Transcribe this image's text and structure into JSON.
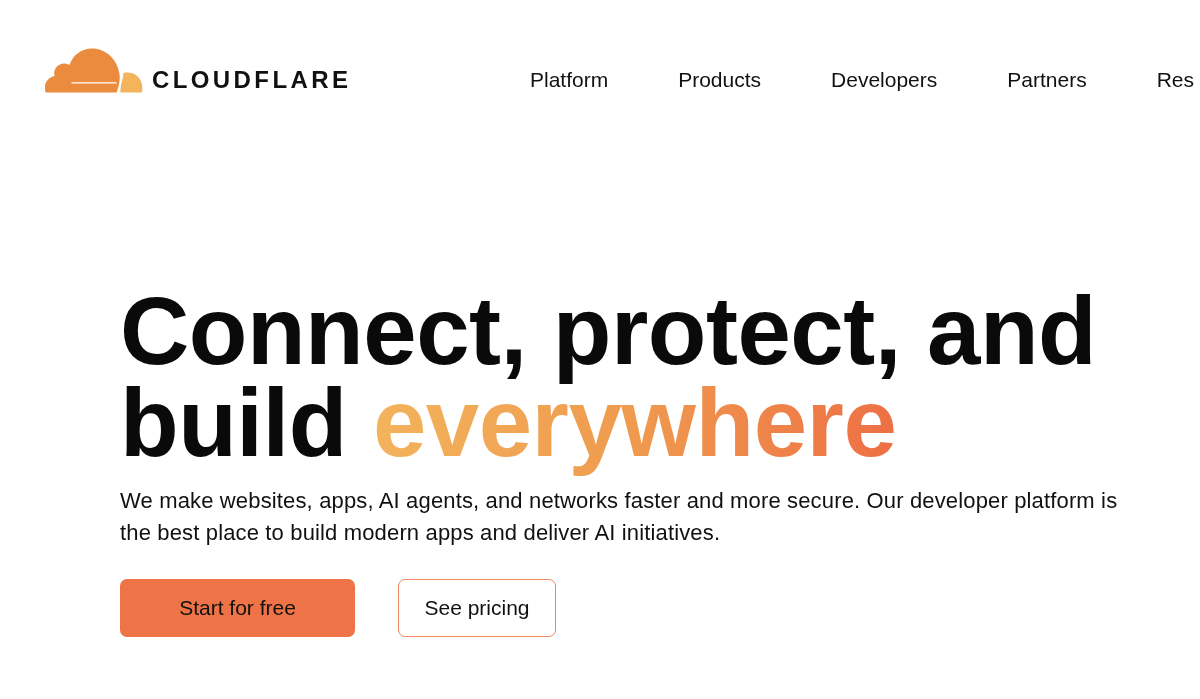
{
  "header": {
    "logo": {
      "wordmark": "CLOUDFLARE"
    },
    "nav": [
      {
        "label": "Platform"
      },
      {
        "label": "Products"
      },
      {
        "label": "Developers"
      },
      {
        "label": "Partners"
      },
      {
        "label": "Res"
      }
    ]
  },
  "hero": {
    "heading": {
      "text": "Connect, protect, and build",
      "highlight": "everywhere"
    },
    "description": "We make websites, apps, AI agents, and networks faster and more secure. Our developer platform is the best place to build modern apps and deliver AI initiatives.",
    "buttons": [
      {
        "label": "Start for free",
        "kind": "primary"
      },
      {
        "label": "See pricing",
        "kind": "secondary"
      }
    ]
  }
}
